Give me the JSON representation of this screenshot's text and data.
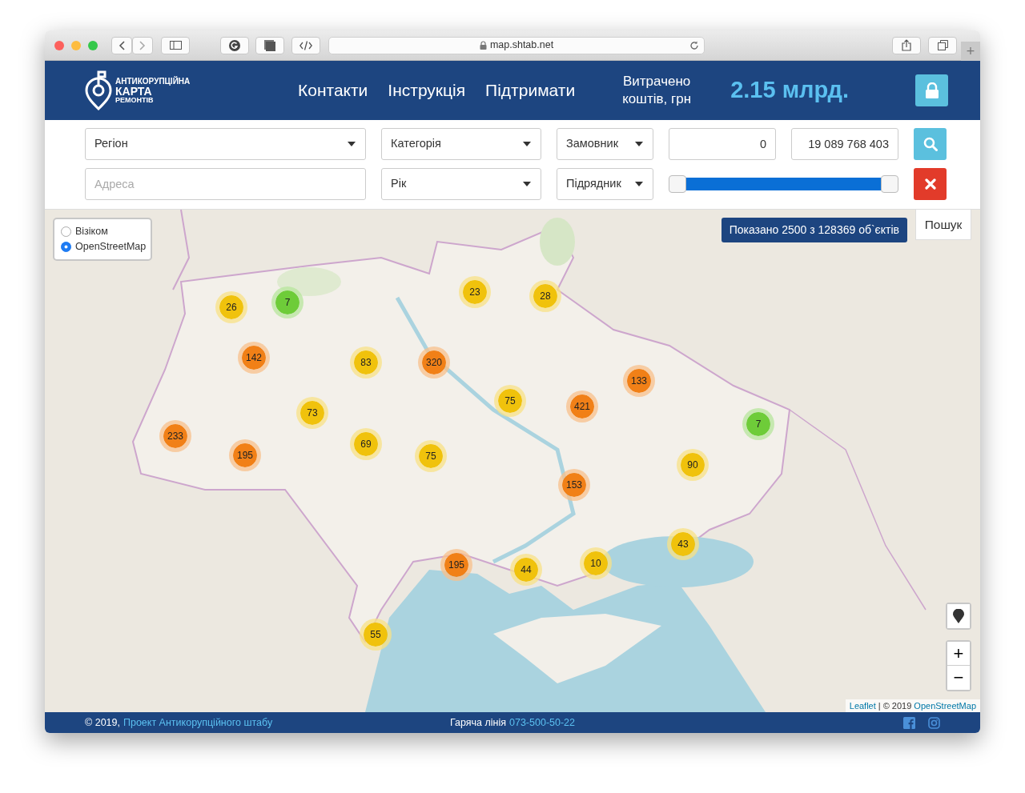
{
  "browser": {
    "url": "map.shtab.net",
    "new_tab": "+"
  },
  "header": {
    "logo": [
      "АНТИКОРУПЦІЙНА",
      "КАРТА",
      "РЕМОНТІВ"
    ],
    "nav": [
      "Контакти",
      "Інструкція",
      "Підтримати"
    ],
    "spent_label": "Витрачено коштів, грн",
    "spent_value": "2.15 млрд."
  },
  "filters": {
    "region": "Регіон",
    "category": "Категорія",
    "customer": "Замовник",
    "min_amount": "0",
    "max_amount": "19 089 768 403",
    "address": {
      "placeholder": "Адреса"
    },
    "year": "Рік",
    "contractor": "Підрядник",
    "amount_range": {
      "level": 1
    }
  },
  "map": {
    "layers": [
      {
        "label": "Візіком",
        "selected": false
      },
      {
        "label": "OpenStreetMap",
        "selected": true
      }
    ],
    "shown_count": "Показано 2500 з 128369 об`єктів",
    "search_tab": "Пошук",
    "clusters": [
      {
        "count": "26",
        "color": "#f0c20c"
      },
      {
        "count": "7",
        "color": "#6ecc39"
      },
      {
        "count": "23",
        "color": "#f0c20c"
      },
      {
        "count": "28",
        "color": "#f0c20c"
      },
      {
        "count": "142",
        "color": "#f18017"
      },
      {
        "count": "83",
        "color": "#f0c20c"
      },
      {
        "count": "320",
        "color": "#f18017"
      },
      {
        "count": "133",
        "color": "#f18017"
      },
      {
        "count": "75",
        "color": "#f0c20c"
      },
      {
        "count": "421",
        "color": "#f18017"
      },
      {
        "count": "73",
        "color": "#f0c20c"
      },
      {
        "count": "7",
        "color": "#6ecc39"
      },
      {
        "count": "233",
        "color": "#f18017"
      },
      {
        "count": "195",
        "color": "#f18017"
      },
      {
        "count": "69",
        "color": "#f0c20c"
      },
      {
        "count": "75",
        "color": "#f0c20c"
      },
      {
        "count": "90",
        "color": "#f0c20c"
      },
      {
        "count": "153",
        "color": "#f18017"
      },
      {
        "count": "43",
        "color": "#f0c20c"
      },
      {
        "count": "195",
        "color": "#f18017"
      },
      {
        "count": "44",
        "color": "#f0c20c"
      },
      {
        "count": "10",
        "color": "#f0c20c"
      },
      {
        "count": "55",
        "color": "#f0c20c"
      }
    ],
    "zoom_in": "+",
    "zoom_out": "−",
    "attribution": {
      "leaflet_link": "Leaflet",
      "separator": "| © 2019",
      "osm_link": "OpenStreetMap"
    }
  },
  "footer": {
    "copyright": "© 2019,",
    "project_link": "Проект Антикорупційного штабу",
    "hotline_label": "Гаряча лінія",
    "hotline_phone": "073-500-50-22"
  }
}
